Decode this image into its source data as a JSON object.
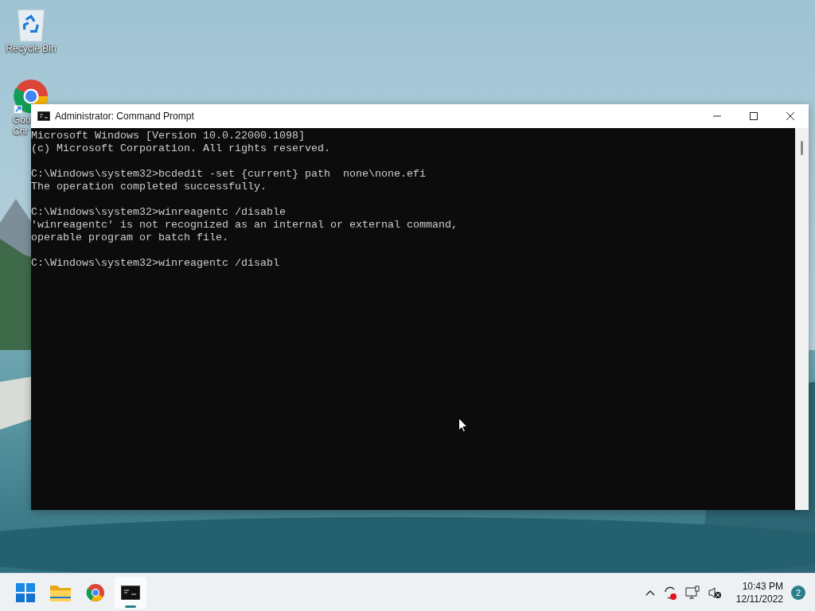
{
  "desktop_icons": [
    {
      "kind": "recycle",
      "label_lines": [
        "Recycle Bin"
      ]
    },
    {
      "kind": "chrome",
      "label_lines": [
        "Goo",
        "Chr"
      ]
    }
  ],
  "window": {
    "title": "Administrator: Command Prompt"
  },
  "console": {
    "blocks": [
      [
        "Microsoft Windows [Version 10.0.22000.1098]",
        "(c) Microsoft Corporation. All rights reserved."
      ],
      [
        "C:\\Windows\\system32>bcdedit -set {current} path  none\\none.efi",
        "The operation completed successfully."
      ],
      [
        "C:\\Windows\\system32>winreagentc /disable",
        "'winreagentc' is not recognized as an internal or external command,",
        "operable program or batch file."
      ],
      [
        "C:\\Windows\\system32>winreagentc /disabl"
      ]
    ]
  },
  "taskbar": {
    "apps": [
      {
        "kind": "start",
        "selected": false
      },
      {
        "kind": "folder",
        "selected": false
      },
      {
        "kind": "chrome",
        "selected": false
      },
      {
        "kind": "terminal",
        "selected": true
      }
    ],
    "time": "10:43 PM",
    "date": "12/11/2022",
    "notification_count": "2"
  }
}
